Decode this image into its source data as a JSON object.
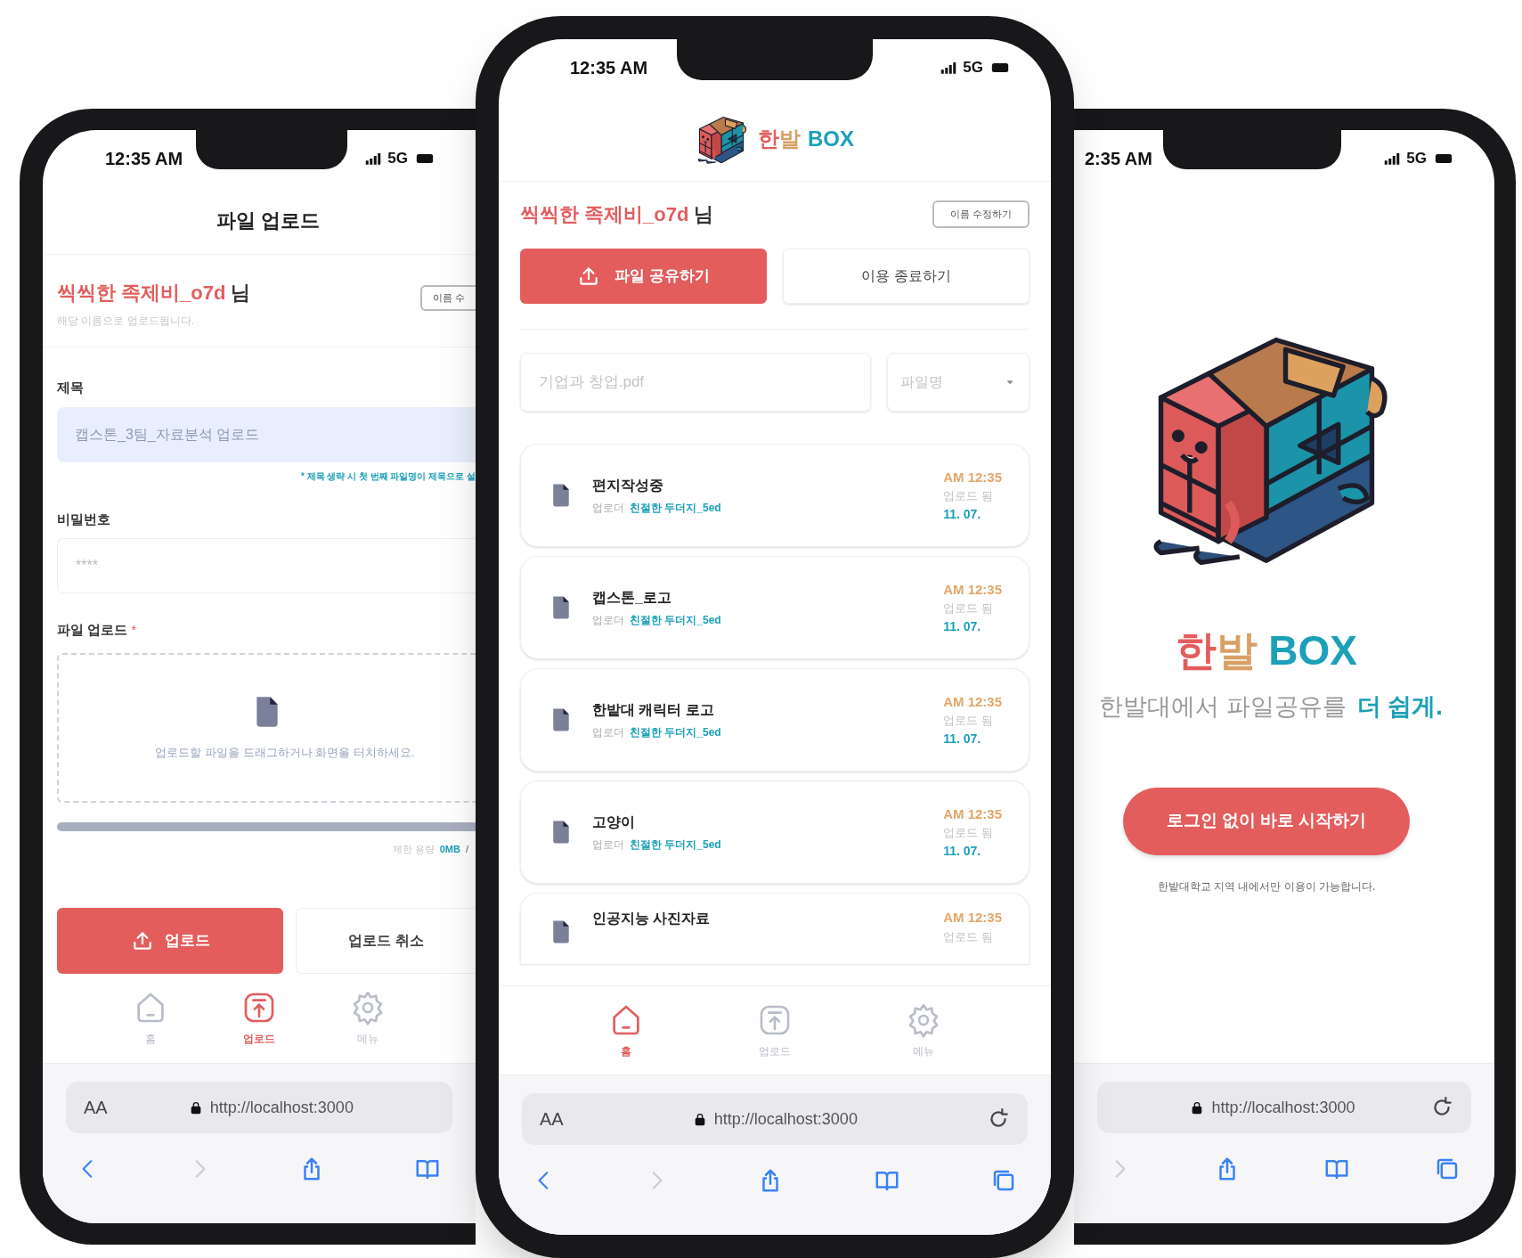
{
  "upload_screen": {
    "status": {
      "time": "12:35 AM",
      "network": "5G"
    },
    "title": "파일 업로드",
    "user": {
      "name": "씩씩한 족제비_o7d",
      "suffix": "님",
      "note": "해당 이름으로 업로드됩니다.",
      "edit_button": "이름 수"
    },
    "fields": [
      {
        "label": "제목",
        "placeholder": "캡스톤_3팀_자료분석 업로드",
        "hint": "* 제목 생략 시 첫 번째 파일명이 제목으로 설"
      },
      {
        "label": "비밀번호",
        "placeholder": "****"
      }
    ],
    "dropzone": {
      "label": "파일 업로드",
      "required_mark": "*",
      "text": "업로드할 파일을 드래그하거나 화면을 터치하세요."
    },
    "storage": {
      "level": 1,
      "label": "제한 용량",
      "value": "0MB",
      "separator": "/"
    },
    "buttons": {
      "upload": "업로드",
      "cancel": "업로드 취소"
    },
    "nav": [
      {
        "label": "홈",
        "selected": false
      },
      {
        "label": "업로드",
        "selected": true
      },
      {
        "label": "메뉴",
        "selected": false
      }
    ],
    "browser": {
      "text_size": "AA",
      "url": "http://localhost:3000"
    }
  },
  "home_screen": {
    "status": {
      "time": "12:35 AM",
      "network": "5G"
    },
    "brand": {
      "korean": "한발",
      "latin": "BOX"
    },
    "user": {
      "name": "씩씩한 족제비_o7d",
      "suffix": "님",
      "edit_button": "이름 수정하기"
    },
    "actions": {
      "share": "파일 공유하기",
      "end": "이용 종료하기"
    },
    "search": {
      "placeholder": "기업과 창업.pdf"
    },
    "sort": {
      "value": "파일명"
    },
    "files": [
      {
        "title": "편지작성중",
        "uploader_label": "업로더",
        "uploader": "친절한 두더지_5ed",
        "time": "AM 12:35",
        "state": "업로드 됨",
        "date": "11. 07."
      },
      {
        "title": "캡스톤_로고",
        "uploader_label": "업로더",
        "uploader": "친절한 두더지_5ed",
        "time": "AM 12:35",
        "state": "업로드 됨",
        "date": "11. 07."
      },
      {
        "title": "한밭대 캐릭터 로고",
        "uploader_label": "업로더",
        "uploader": "친절한 두더지_5ed",
        "time": "AM 12:35",
        "state": "업로드 됨",
        "date": "11. 07."
      },
      {
        "title": "고양이",
        "uploader_label": "업로더",
        "uploader": "친절한 두더지_5ed",
        "time": "AM 12:35",
        "state": "업로드 됨",
        "date": "11. 07."
      },
      {
        "title": "인공지능 사진자료",
        "time": "AM 12:35",
        "state": "업로드 됨"
      }
    ],
    "nav": [
      {
        "label": "홈",
        "selected": true
      },
      {
        "label": "업로드",
        "selected": false
      },
      {
        "label": "메뉴",
        "selected": false
      }
    ],
    "browser": {
      "text_size": "AA",
      "url": "http://localhost:3000"
    }
  },
  "start_screen": {
    "status": {
      "time": "2:35 AM",
      "network": "5G"
    },
    "brand": {
      "korean": "한발",
      "latin": "BOX"
    },
    "tagline": {
      "text": "한발대에서 파일공유를",
      "emphasis": "더 쉽게."
    },
    "start_button": "로그인 없이 바로 시작하기",
    "note": "한밭대학교 지역 내에서만 이용이 가능합니다.",
    "browser": {
      "url": "http://localhost:3000"
    }
  }
}
